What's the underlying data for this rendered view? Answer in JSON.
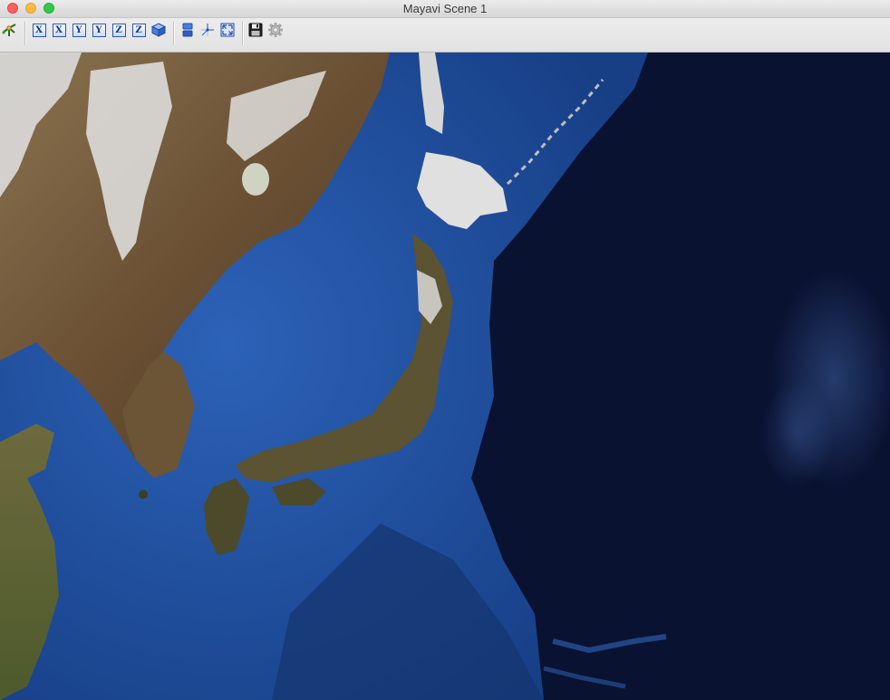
{
  "window": {
    "title": "Mayavi Scene 1"
  },
  "toolbar": {
    "buttons": [
      {
        "name": "mayavi-pipeline-button",
        "icon": "pipeline-icon"
      },
      {
        "name": "view-x-minus-button",
        "label": "X",
        "icon": "x-axis-view-icon"
      },
      {
        "name": "view-x-plus-button",
        "label": "X",
        "icon": "x-axis-view-icon"
      },
      {
        "name": "view-y-minus-button",
        "label": "Y",
        "icon": "y-axis-view-icon"
      },
      {
        "name": "view-y-plus-button",
        "label": "Y",
        "icon": "y-axis-view-icon"
      },
      {
        "name": "view-z-minus-button",
        "label": "Z",
        "icon": "z-axis-view-icon"
      },
      {
        "name": "view-z-plus-button",
        "label": "Z",
        "icon": "z-axis-view-icon"
      },
      {
        "name": "isometric-view-button",
        "icon": "cube-icon"
      },
      {
        "name": "parallel-projection-button",
        "icon": "projection-icon"
      },
      {
        "name": "show-axes-button",
        "icon": "axes-icon"
      },
      {
        "name": "full-screen-button",
        "icon": "fullscreen-icon"
      },
      {
        "name": "save-scene-button",
        "icon": "floppy-disk-icon"
      },
      {
        "name": "configure-scene-button",
        "icon": "gear-icon"
      }
    ]
  },
  "scene": {
    "content": "satellite earth texture of East Asia",
    "colors": {
      "deep_ocean": "#0a1130",
      "shelf_ocean": "#1e4f9e",
      "land": "#5a4a2e",
      "snow": "#e6e6e6"
    }
  }
}
